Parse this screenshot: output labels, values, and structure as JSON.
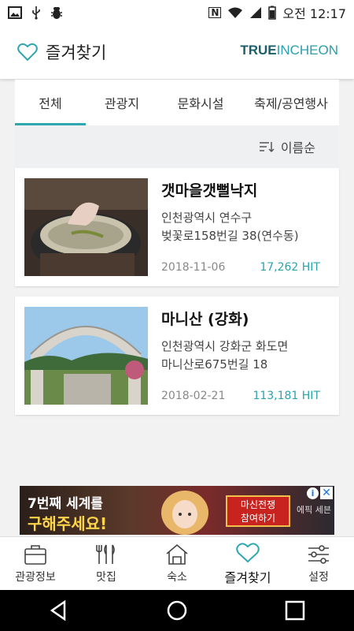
{
  "status_bar": {
    "carrier_glyph": "N",
    "time": "오전 12:17",
    "icons": [
      "image-icon",
      "usb-icon",
      "bug-icon",
      "nfc-icon",
      "wifi-icon",
      "signal-icon",
      "battery-icon"
    ]
  },
  "header": {
    "title": "즐겨찾기",
    "brand_bold": "TRUE",
    "brand_light": "INCHEON",
    "accent_color": "#2fa7b0"
  },
  "tabs": [
    {
      "label": "전체",
      "active": true
    },
    {
      "label": "관광지",
      "active": false
    },
    {
      "label": "문화시설",
      "active": false
    },
    {
      "label": "축제/공연행사",
      "active": false
    }
  ],
  "sort": {
    "label": "이름순"
  },
  "items": [
    {
      "name": "갯마을갯뻘낙지",
      "address_line1": "인천광역시 연수구",
      "address_line2": "벚꽃로158번길 38(연수동)",
      "date": "2018-11-06",
      "hits": "17,262 HIT"
    },
    {
      "name": "마니산 (강화)",
      "address_line1": "인천광역시 강화군 화도면",
      "address_line2": "마니산로675번길 18",
      "date": "2018-02-21",
      "hits": "113,181 HIT"
    }
  ],
  "ad": {
    "line1": "7번째 세계를",
    "line2": "구해주세요!",
    "cta_line1": "마신전쟁",
    "cta_line2": "참여하기",
    "side_text": "에픽 세븐"
  },
  "bottom_nav": [
    {
      "label": "관광정보",
      "icon": "briefcase-icon",
      "active": false
    },
    {
      "label": "맛집",
      "icon": "utensils-icon",
      "active": false
    },
    {
      "label": "숙소",
      "icon": "house-icon",
      "active": false
    },
    {
      "label": "즐겨찾기",
      "icon": "heart-icon",
      "active": true
    },
    {
      "label": "설정",
      "icon": "sliders-icon",
      "active": false
    }
  ]
}
